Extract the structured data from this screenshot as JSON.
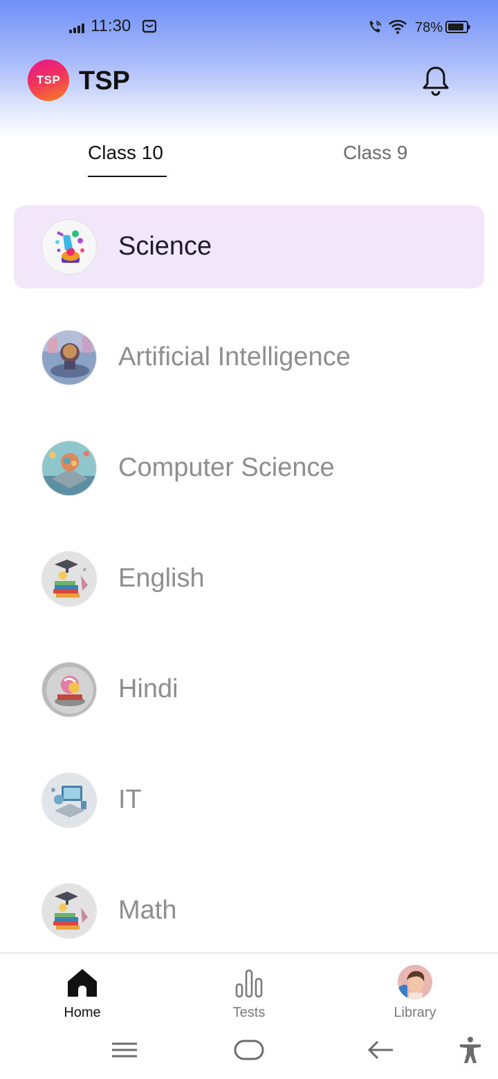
{
  "status_bar": {
    "time": "11:30",
    "battery": "78%",
    "icons": [
      "signal-icon",
      "message-icon",
      "wifi-call-icon",
      "wifi-icon",
      "battery-icon"
    ]
  },
  "header": {
    "logo_text": "TSP",
    "title": "TSP",
    "notification_icon": "bell-icon"
  },
  "tabs": [
    {
      "label": "Class 10",
      "active": true
    },
    {
      "label": "Class 9",
      "active": false
    }
  ],
  "subjects": [
    {
      "label": "Science",
      "selected": true,
      "icon": "science-icon"
    },
    {
      "label": "Artificial Intelligence",
      "selected": false,
      "icon": "ai-icon"
    },
    {
      "label": "Computer Science",
      "selected": false,
      "icon": "computer-science-icon"
    },
    {
      "label": "English",
      "selected": false,
      "icon": "books-icon"
    },
    {
      "label": "Hindi",
      "selected": false,
      "icon": "hindi-icon"
    },
    {
      "label": "IT",
      "selected": false,
      "icon": "it-icon"
    },
    {
      "label": "Math",
      "selected": false,
      "icon": "books-icon"
    }
  ],
  "bottom_nav": [
    {
      "label": "Home",
      "icon": "home-icon",
      "active": true
    },
    {
      "label": "Tests",
      "icon": "bar-chart-icon",
      "active": false
    },
    {
      "label": "Library",
      "icon": "profile-avatar",
      "active": false
    }
  ],
  "system_nav": [
    "menu-icon",
    "home-pill-icon",
    "back-icon",
    "accessibility-icon"
  ],
  "colors": {
    "selected_bg": "#f2e6fb",
    "header_gradient_top": "#6f8ff7",
    "logo_gradient": [
      "#e8178c",
      "#f7831f"
    ],
    "inactive_text": "#8e8e8e"
  }
}
